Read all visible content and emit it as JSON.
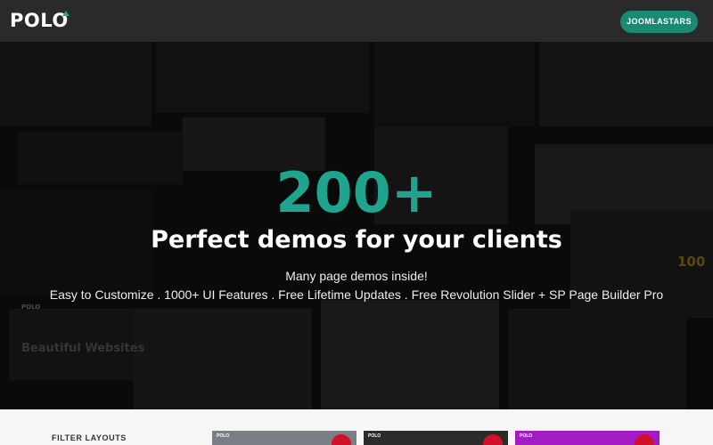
{
  "header": {
    "logo": "POLO",
    "cta_label": "JOOMLASTARS"
  },
  "hero": {
    "big_number": "200+",
    "headline": "Perfect demos for your clients",
    "subline": "Many page demos inside!",
    "features": "Easy to Customize . 1000+ UI Features . Free Lifetime Updates . Free Revolution Slider + SP Page Builder Pro",
    "background_text": {
      "beautiful_websites": "Beautiful Websites",
      "polo": "POLO",
      "number_100": "100"
    }
  },
  "bottom": {
    "filter_title": "FILTER LAYOUTS",
    "thumb_labels": [
      "POLO",
      "POLO",
      "POLO"
    ]
  },
  "colors": {
    "accent": "#1fa58f",
    "cta": "#1b8a75",
    "header_bg": "#2a2a2a",
    "badge": "#d2102b"
  }
}
